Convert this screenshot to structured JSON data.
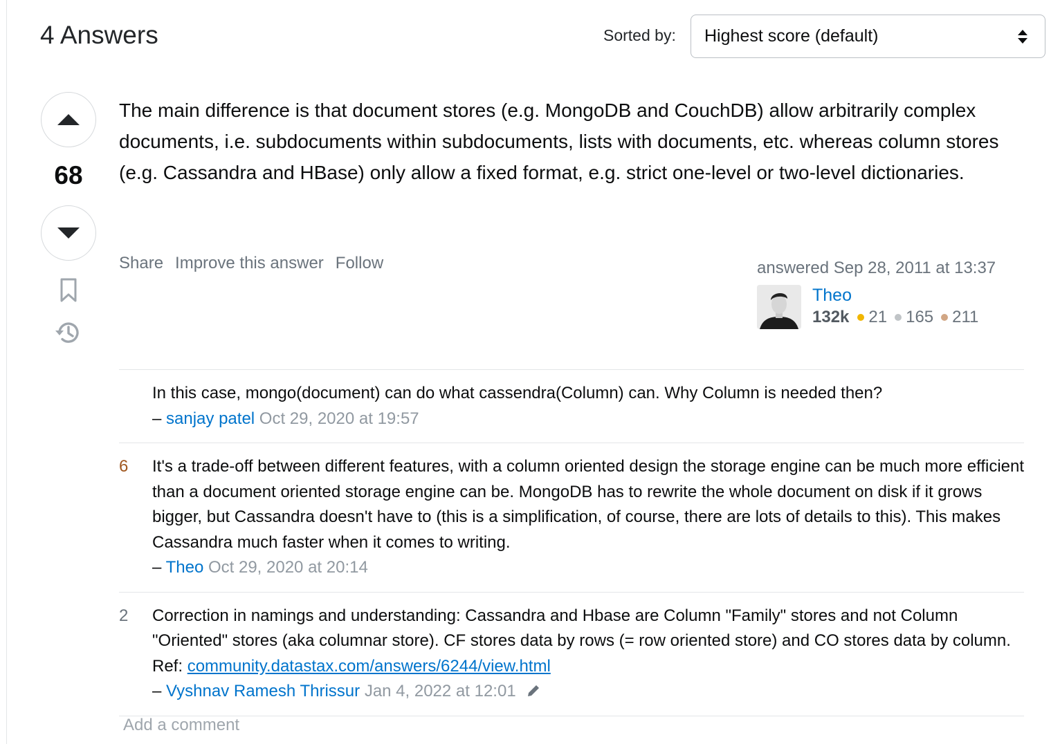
{
  "header": {
    "answers_title": "4 Answers",
    "sort_label": "Sorted by:",
    "sort_value": "Highest score (default)"
  },
  "answer": {
    "vote_count": "68",
    "body": "The main difference is that document stores (e.g. MongoDB and CouchDB) allow arbitrarily complex documents, i.e. subdocuments within subdocuments, lists with documents, etc. whereas column stores (e.g. Cassandra and HBase) only allow a fixed format, e.g. strict one-level or two-level dictionaries.",
    "menu": {
      "share": "Share",
      "improve": "Improve this answer",
      "follow": "Follow"
    },
    "user": {
      "action": "answered Sep 28, 2011 at 13:37",
      "name": "Theo",
      "reputation": "132k",
      "gold": "21",
      "silver": "165",
      "bronze": "211"
    }
  },
  "comments": [
    {
      "score": "",
      "text": "In this case, mongo(document) can do what cassendra(Column) can. Why Column is needed then?",
      "dash": "–",
      "user": "sanjay patel",
      "date": "Oct 29, 2020 at 19:57"
    },
    {
      "score": "6",
      "text": "It's a trade-off between different features, with a column oriented design the storage engine can be much more efficient than a document oriented storage engine can be. MongoDB has to rewrite the whole document on disk if it grows bigger, but Cassandra doesn't have to (this is a simplification, of course, there are lots of details to this). This makes Cassandra much faster when it comes to writing.",
      "dash": "–",
      "user": "Theo",
      "date": "Oct 29, 2020 at 20:14"
    },
    {
      "score": "2",
      "text": "Correction in namings and understanding: Cassandra and Hbase are Column \"Family\" stores and not Column \"Oriented\" stores (aka columnar store). CF stores data by rows (= row oriented store) and CO stores data by column. Ref: ",
      "link": "community.datastax.com/answers/6244/view.html",
      "dash": "–",
      "user": "Vyshnav Ramesh Thrissur",
      "date": "Jan 4, 2022 at 12:01"
    }
  ],
  "add_comment": "Add a comment",
  "colors": {
    "link": "#0074cc",
    "muted": "#6a737c",
    "gold": "#f1b600",
    "silver": "#c0c4c7",
    "bronze": "#d1a684",
    "hot_score": "#a0571f"
  },
  "icons": {
    "vote_up": "triangle-up-icon",
    "vote_down": "triangle-down-icon",
    "bookmark": "bookmark-icon",
    "history": "history-icon",
    "sort": "sort-arrows-icon",
    "edit": "pencil-icon"
  }
}
